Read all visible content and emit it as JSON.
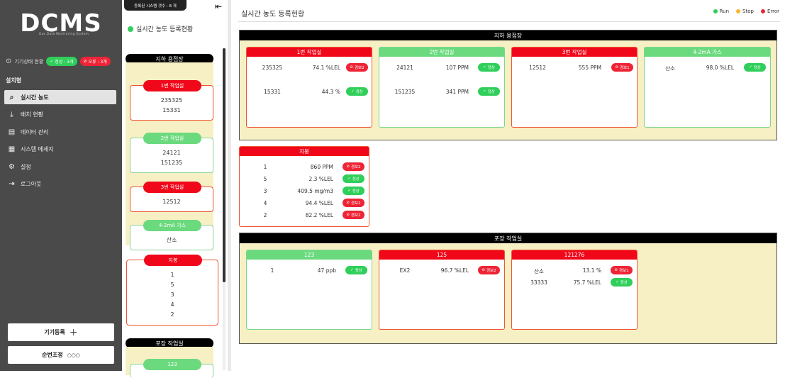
{
  "sidebar": {
    "logo": "DCMS",
    "logo_sub": "Gas Data Monitoring System",
    "device_status_label": "기기상태 현황",
    "normal_badge": "정상 : 3개",
    "error_badge": "오류 : 3개",
    "section_label": "설치형",
    "menu": [
      {
        "label": "실시간 농도",
        "icon": "search-icon",
        "active": true
      },
      {
        "label": "배치 현황",
        "icon": "download-icon",
        "active": false
      },
      {
        "label": "데이터 관리",
        "icon": "clipboard-icon",
        "active": false
      },
      {
        "label": "시스템 메세지",
        "icon": "document-icon",
        "active": false
      },
      {
        "label": "설정",
        "icon": "gear-icon",
        "active": false
      },
      {
        "label": "로그아웃",
        "icon": "logout-icon",
        "active": false
      }
    ],
    "register_button": "기기등록",
    "order_button": "순번조정"
  },
  "mid": {
    "top_badge": "등록된 시스템 갯수 : 8 개",
    "title": "실시간 농도 등록현황",
    "group1": {
      "name": "지하 용접장",
      "cards": [
        {
          "name": "1번 작업실",
          "color": "red",
          "values": [
            "235325",
            "15331"
          ]
        },
        {
          "name": "2번 작업실",
          "color": "green",
          "values": [
            "24121",
            "151235"
          ]
        },
        {
          "name": "3번 작업실",
          "color": "red",
          "values": [
            "12512"
          ]
        },
        {
          "name": "4-2mA 가스",
          "color": "green",
          "values": [
            "산소"
          ]
        }
      ]
    },
    "roof": {
      "name": "지붕",
      "values": [
        "1",
        "5",
        "3",
        "4",
        "2"
      ]
    },
    "group3": {
      "name": "포장 작업실",
      "first_card": "123"
    }
  },
  "main": {
    "title": "실시간 농도 등록현황",
    "legend": [
      {
        "label": "Run",
        "color": "#2fcf5a"
      },
      {
        "label": "Stop",
        "color": "#f5b731"
      },
      {
        "label": "Error",
        "color": "#ee2436"
      }
    ],
    "areas": [
      {
        "name": "지하 용접장",
        "cards": [
          {
            "name": "1번 작업실",
            "color": "red",
            "rows": [
              {
                "id": "235325",
                "value": "74.1 %LEL",
                "status": "경보2",
                "type": "alarm"
              },
              {
                "id": "15331",
                "value": "44.3 %",
                "status": "정상",
                "type": "ok"
              }
            ]
          },
          {
            "name": "2번 작업실",
            "color": "green",
            "rows": [
              {
                "id": "24121",
                "value": "107 PPM",
                "status": "정상",
                "type": "ok"
              },
              {
                "id": "151235",
                "value": "341 PPM",
                "status": "정상",
                "type": "ok"
              }
            ]
          },
          {
            "name": "3번 작업실",
            "color": "red",
            "rows": [
              {
                "id": "12512",
                "value": "555 PPM",
                "status": "경보1",
                "type": "alarm"
              }
            ]
          },
          {
            "name": "4-2mA 가스",
            "color": "green",
            "rows": [
              {
                "id": "산소",
                "value": "98.0 %LEL",
                "status": "정상",
                "type": "ok"
              }
            ]
          }
        ]
      },
      {
        "name": "지붕",
        "cards": [
          {
            "name": "지붕",
            "color": "red",
            "rows": [
              {
                "id": "1",
                "value": "860 PPM",
                "status": "경보2",
                "type": "alarm"
              },
              {
                "id": "5",
                "value": "2.3 %LEL",
                "status": "정상",
                "type": "ok"
              },
              {
                "id": "3",
                "value": "409.5 mg/m3",
                "status": "정상",
                "type": "ok"
              },
              {
                "id": "4",
                "value": "94.4 %LEL",
                "status": "경보2",
                "type": "alarm"
              },
              {
                "id": "2",
                "value": "82.2 %LEL",
                "status": "경보2",
                "type": "alarm"
              }
            ]
          }
        ]
      },
      {
        "name": "포장 작업실",
        "cards": [
          {
            "name": "123",
            "color": "green",
            "rows": [
              {
                "id": "1",
                "value": "47 ppb",
                "status": "정상",
                "type": "ok"
              }
            ]
          },
          {
            "name": "125",
            "color": "red",
            "rows": [
              {
                "id": "EX2",
                "value": "96.7 %LEL",
                "status": "경보2",
                "type": "alarm"
              }
            ]
          },
          {
            "name": "121276",
            "color": "red",
            "rows": [
              {
                "id": "산소",
                "value": "13.1 %",
                "status": "경보1",
                "type": "alarm"
              },
              {
                "id": "33333",
                "value": "75.7 %LEL",
                "status": "정상",
                "type": "ok"
              }
            ]
          }
        ]
      }
    ]
  }
}
